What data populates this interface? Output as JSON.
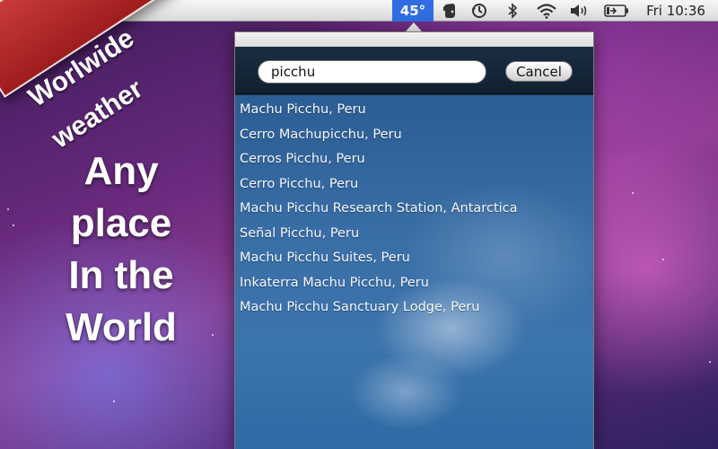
{
  "menubar": {
    "temperature": "45°",
    "clock": "Fri 10:36",
    "icons": [
      "evernote-icon",
      "time-machine-icon",
      "bluetooth-icon",
      "wifi-icon",
      "volume-icon",
      "battery-icon"
    ]
  },
  "popup": {
    "search": {
      "value": "picchu",
      "placeholder": ""
    },
    "cancel_label": "Cancel",
    "results": [
      "Machu Picchu, Peru",
      "Cerro Machupicchu, Peru",
      "Cerros Picchu, Peru",
      "Cerro Picchu, Peru",
      "Machu Picchu Research Station, Antarctica",
      "Señal Picchu, Peru",
      "Machu Picchu Suites, Peru",
      "Inkaterra Machu Picchu, Peru",
      "Machu Picchu Sanctuary Lodge, Peru"
    ]
  },
  "promo": {
    "ribbon_line1": "Worlwide",
    "ribbon_line2": "weather",
    "headline": [
      "Any",
      "place",
      "In the",
      "World"
    ]
  },
  "colors": {
    "menubar_highlight": "#2f6de1",
    "ribbon": "#b52b2b"
  }
}
